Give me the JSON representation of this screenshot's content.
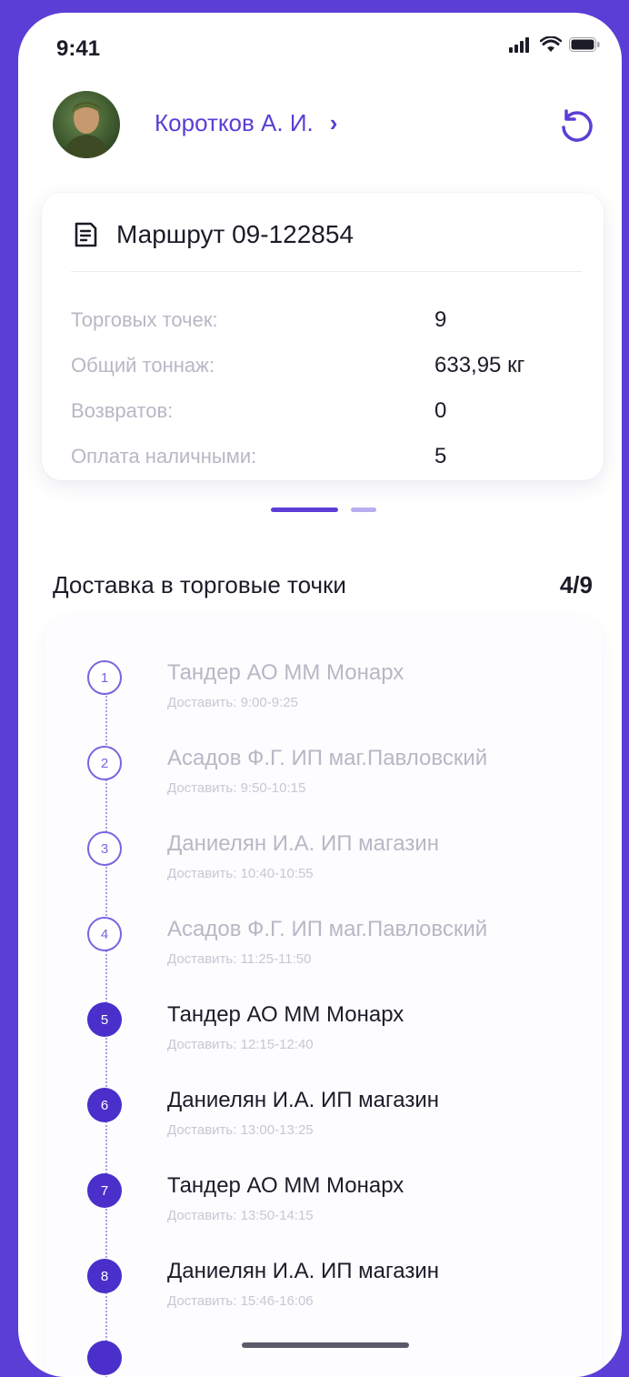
{
  "status_bar": {
    "time": "9:41"
  },
  "header": {
    "user_name": "Коротков А. И.",
    "chevron": "›",
    "icons": [
      "avatar",
      "chevron-right-icon",
      "refresh-icon"
    ]
  },
  "route": {
    "title": "Маршрут 09-122854",
    "stats": [
      {
        "label": "Торговых точек:",
        "value": "9"
      },
      {
        "label": "Общий тоннаж:",
        "value": "633,95 кг"
      },
      {
        "label": "Возвратов:",
        "value": "0"
      },
      {
        "label": "Оплата наличными:",
        "value": "5"
      }
    ]
  },
  "deliveries": {
    "title": "Доставка в торговые точки",
    "count": "4/9",
    "stops": [
      {
        "number": "1",
        "name": "Тандер АО ММ Монарх",
        "time": "Доставить: 9:00-9:25",
        "status": "done"
      },
      {
        "number": "2",
        "name": "Асадов Ф.Г. ИП маг.Павловский",
        "time": "Доставить: 9:50-10:15",
        "status": "done"
      },
      {
        "number": "3",
        "name": "Даниелян И.А. ИП магазин",
        "time": "Доставить: 10:40-10:55",
        "status": "done"
      },
      {
        "number": "4",
        "name": "Асадов Ф.Г. ИП маг.Павловский",
        "time": "Доставить: 11:25-11:50",
        "status": "done"
      },
      {
        "number": "5",
        "name": "Тандер АО ММ Монарх",
        "time": "Доставить: 12:15-12:40",
        "status": "pending"
      },
      {
        "number": "6",
        "name": "Даниелян И.А. ИП магазин",
        "time": "Доставить: 13:00-13:25",
        "status": "pending"
      },
      {
        "number": "7",
        "name": "Тандер АО ММ Монарх",
        "time": "Доставить: 13:50-14:15",
        "status": "pending"
      },
      {
        "number": "8",
        "name": "Даниелян И.А. ИП магазин",
        "time": "Доставить: 15:46-16:06",
        "status": "pending"
      }
    ]
  },
  "colors": {
    "accent": "#5b3ed6",
    "marker_filled": "#4a2fcb",
    "text_primary": "#1c1c28",
    "text_muted": "#b9b7c4"
  }
}
